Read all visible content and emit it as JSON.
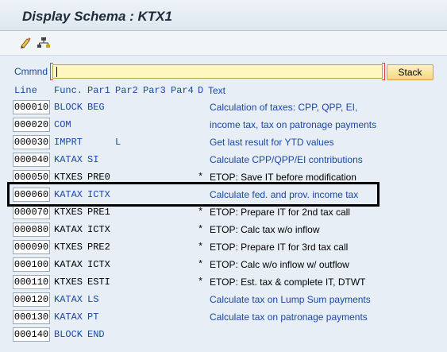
{
  "title": "Display Schema : KTX1",
  "toolbar": {
    "icons": [
      "edit-pencil-icon",
      "hierarchy-icon"
    ]
  },
  "command": {
    "label": "Cmmnd",
    "value": "",
    "stack_label": "Stack"
  },
  "columns": {
    "line": "Line",
    "func": "Func.",
    "par1": "Par1",
    "par2": "Par2",
    "par3": "Par3",
    "par4": "Par4",
    "d": "D",
    "text": "Text"
  },
  "rows": [
    {
      "line": "000010",
      "func": "BLOCK",
      "par1": "BEG",
      "par2": "",
      "d": "",
      "text": "Calculation of taxes: CPP, QPP, EI,",
      "active": true
    },
    {
      "line": "000020",
      "func": "COM",
      "par1": "",
      "par2": "",
      "d": "",
      "text": "income tax, tax on patronage payments",
      "active": true
    },
    {
      "line": "000030",
      "func": "IMPRT",
      "par1": "",
      "par2": "L",
      "d": "",
      "text": "Get last result for YTD values",
      "active": true
    },
    {
      "line": "000040",
      "func": "KATAX",
      "par1": "SI",
      "par2": "",
      "d": "",
      "text": "Calculate CPP/QPP/EI contributions",
      "active": true
    },
    {
      "line": "000050",
      "func": "KTXES",
      "par1": "PRE0",
      "par2": "",
      "d": "*",
      "text": "ETOP: Save IT before modification",
      "active": false
    },
    {
      "line": "000060",
      "func": "KATAX",
      "par1": "ICTX",
      "par2": "",
      "d": "",
      "text": "Calculate fed. and prov. income tax",
      "active": true
    },
    {
      "line": "000070",
      "func": "KTXES",
      "par1": "PRE1",
      "par2": "",
      "d": "*",
      "text": "ETOP: Prepare IT for 2nd tax call",
      "active": false
    },
    {
      "line": "000080",
      "func": "KATAX",
      "par1": "ICTX",
      "par2": "",
      "d": "*",
      "text": "ETOP: Calc tax w/o inflow",
      "active": false
    },
    {
      "line": "000090",
      "func": "KTXES",
      "par1": "PRE2",
      "par2": "",
      "d": "*",
      "text": "ETOP: Prepare IT for 3rd tax call",
      "active": false
    },
    {
      "line": "000100",
      "func": "KATAX",
      "par1": "ICTX",
      "par2": "",
      "d": "*",
      "text": "ETOP: Calc  w/o inflow w/ outflow",
      "active": false
    },
    {
      "line": "000110",
      "func": "KTXES",
      "par1": "ESTI",
      "par2": "",
      "d": "*",
      "text": "ETOP: Est. tax & complete IT, DTWT",
      "active": false
    },
    {
      "line": "000120",
      "func": "KATAX",
      "par1": "LS",
      "par2": "",
      "d": "",
      "text": "Calculate tax on Lump Sum payments",
      "active": true
    },
    {
      "line": "000130",
      "func": "KATAX",
      "par1": "PT",
      "par2": "",
      "d": "",
      "text": "Calculate tax on patronage payments",
      "active": true
    },
    {
      "line": "000140",
      "func": "BLOCK",
      "par1": "END",
      "par2": "",
      "d": "",
      "text": "",
      "active": true
    }
  ],
  "colors": {
    "active": "#1a47a8",
    "commented": "#000000",
    "command_field": "#fff7bf",
    "button": "#f3d87d"
  }
}
